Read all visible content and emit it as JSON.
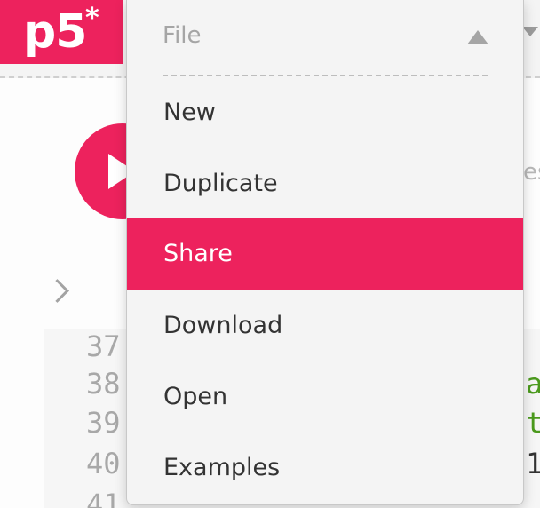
{
  "app": {
    "logo_text": "p5",
    "logo_star": "*",
    "unsaved_indicator": "*"
  },
  "background": {
    "partial_text": "es",
    "line_numbers": [
      "37",
      "38",
      "39",
      "40",
      "41"
    ],
    "code_fragments": [
      {
        "text": "a",
        "color": "#4b9a1d"
      },
      {
        "text": "t",
        "color": "#4b9a1d"
      },
      {
        "text": "1",
        "color": "#333333"
      }
    ]
  },
  "file_menu": {
    "title": "File",
    "items": [
      {
        "label": "New",
        "active": false
      },
      {
        "label": "Duplicate",
        "active": false
      },
      {
        "label": "Share",
        "active": true
      },
      {
        "label": "Download",
        "active": false
      },
      {
        "label": "Open",
        "active": false
      },
      {
        "label": "Examples",
        "active": false
      }
    ]
  },
  "colors": {
    "accent": "#ed225d",
    "menu_bg": "#f4f4f4",
    "menu_text": "#333333",
    "muted_text": "#a5a5a5"
  },
  "icons": {
    "menu_caret": "caret-up-icon",
    "top_caret": "caret-down-icon",
    "play": "play-icon",
    "sidebar_toggle": "chevron-right-icon"
  }
}
